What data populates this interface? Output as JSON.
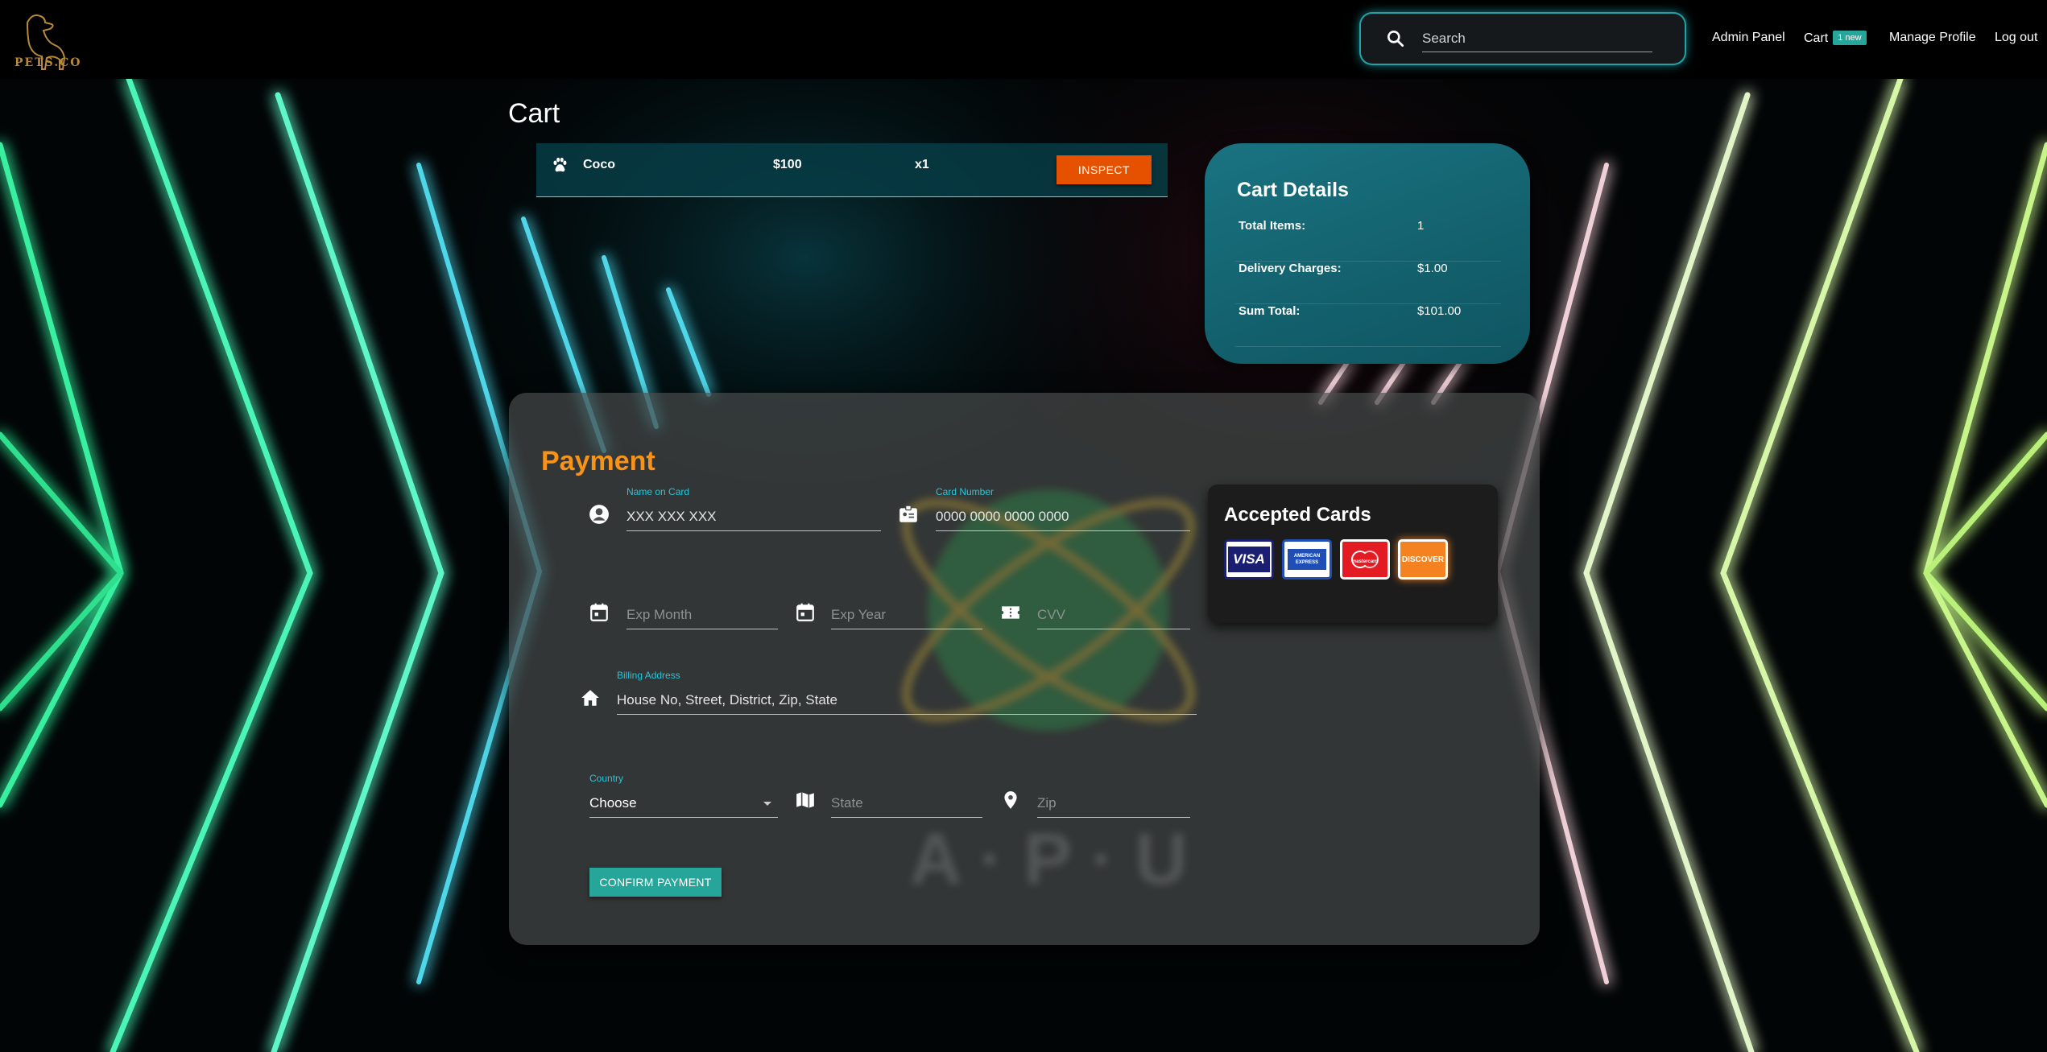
{
  "brand": {
    "name": "PETS.CO"
  },
  "navbar": {
    "search_placeholder": "Search",
    "links": {
      "admin": "Admin Panel",
      "cart": "Cart",
      "cart_badge": "1 new",
      "profile": "Manage Profile",
      "logout": "Log out"
    }
  },
  "cart": {
    "title": "Cart",
    "items": [
      {
        "icon": "paw-icon",
        "name": "Coco",
        "price": "$100",
        "qty": "x1",
        "action": "INSPECT"
      }
    ]
  },
  "cart_details": {
    "title": "Cart Details",
    "rows": [
      {
        "label": "Total Items:",
        "value": "1"
      },
      {
        "label": "Delivery Charges:",
        "value": "$1.00"
      },
      {
        "label": "Sum Total:",
        "value": "$101.00"
      }
    ]
  },
  "payment": {
    "title": "Payment",
    "name_on_card": {
      "label": "Name on Card",
      "placeholder": "XXX XXX XXX"
    },
    "card_number": {
      "label": "Card Number",
      "placeholder": "0000 0000 0000 0000"
    },
    "exp_month": {
      "placeholder": "Exp Month"
    },
    "exp_year": {
      "placeholder": "Exp Year"
    },
    "cvv": {
      "placeholder": "CVV"
    },
    "billing_address": {
      "label": "Billing Address",
      "placeholder": "House No, Street, District, Zip, State"
    },
    "country": {
      "label": "Country",
      "value": "Choose"
    },
    "state": {
      "placeholder": "State"
    },
    "zip": {
      "placeholder": "Zip"
    },
    "confirm_label": "CONFIRM PAYMENT",
    "watermark_text": "A · P · U"
  },
  "accepted_cards": {
    "title": "Accepted Cards",
    "cards": [
      {
        "name": "VISA",
        "color": "#1a1f71"
      },
      {
        "name": "AMERICAN EXPRESS",
        "color": "#1f4fb5"
      },
      {
        "name": "mastercard",
        "color": "#eb001b"
      },
      {
        "name": "DISCOVER",
        "color": "#f58220"
      }
    ]
  },
  "colors": {
    "accent_teal": "#26a69a",
    "payment_title": "#f7931a",
    "inspect_button": "#e65100",
    "cart_details_bg": "#15677a"
  }
}
